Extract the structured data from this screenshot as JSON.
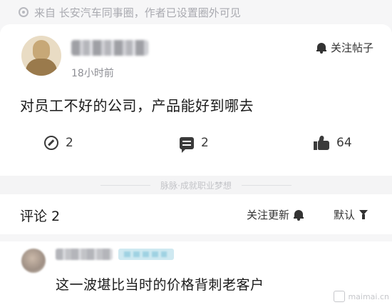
{
  "source_bar": {
    "text": "来自 长安汽车同事圈，作者已设置圈外可见",
    "icon": "info-circle-icon"
  },
  "post": {
    "author_name_blurred": true,
    "time": "18小时前",
    "follow_label": "关注帖子",
    "body": "对员工不好的公司，产品能好到哪去",
    "stats": {
      "shares": "2",
      "comments": "2",
      "likes": "64"
    }
  },
  "divider": {
    "slogan": "脉脉·成就职业梦想"
  },
  "comments": {
    "title": "评论 2",
    "follow_updates_label": "关注更新",
    "sort_label": "默认",
    "items": [
      {
        "author_name_blurred": true,
        "text": "这一波堪比当时的价格背刺老客户"
      }
    ]
  },
  "watermark": {
    "text": "maimai.cn"
  },
  "colors": {
    "background": "#f6f6f7",
    "card": "#ffffff",
    "muted_text": "#a9aab0",
    "primary_text": "#1b1b1b",
    "icon": "#3a3a3a"
  }
}
